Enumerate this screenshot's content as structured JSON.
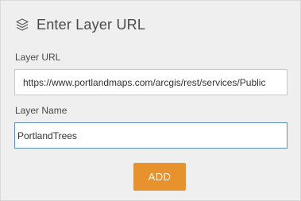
{
  "panel": {
    "icon": "layers-icon",
    "title": "Enter Layer URL"
  },
  "layer_url": {
    "label": "Layer URL",
    "value": "https://www.portlandmaps.com/arcgis/rest/services/Public"
  },
  "layer_name": {
    "label": "Layer Name",
    "value": "PortlandTrees"
  },
  "actions": {
    "add_label": "ADD"
  },
  "colors": {
    "accent": "#e8922d",
    "focus_border": "#5b8fbf",
    "panel_background": "#efefef"
  }
}
